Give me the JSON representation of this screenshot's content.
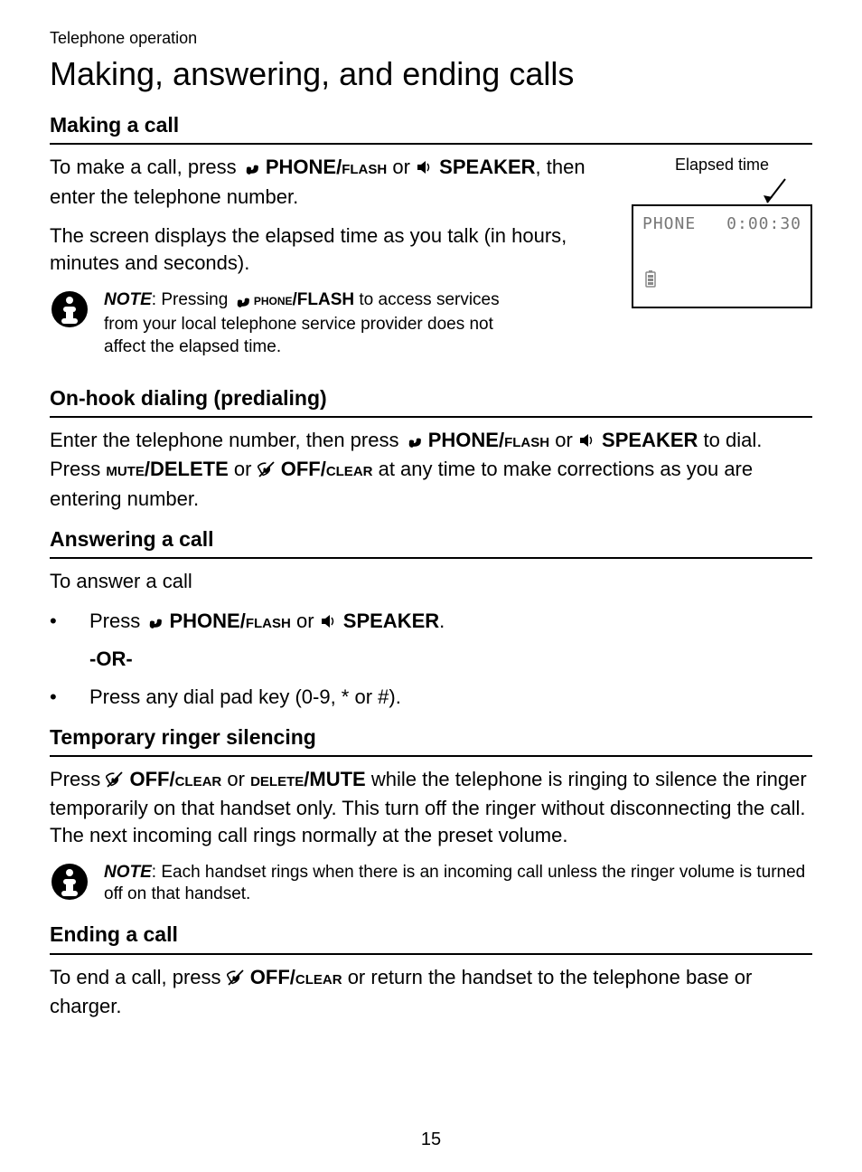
{
  "breadcrumb": "Telephone operation",
  "page_title": "Making, answering, and ending calls",
  "page_number": "15",
  "labels": {
    "phone_flash": "PHONE/",
    "phone_flash_sc": "flash",
    "speaker": "SPEAKER",
    "mute_delete_sc": "mute",
    "mute_delete": "/DELETE",
    "off_clear": "OFF/",
    "off_clear_sc": "clear",
    "delete_mute_sc": "delete",
    "delete_mute": "/MUTE",
    "note": "NOTE",
    "or": "-OR-"
  },
  "screen": {
    "elapsed_label": "Elapsed time",
    "line1_left": "PHONE",
    "line1_right": "0:00:30"
  },
  "sections": {
    "making": {
      "title": "Making a call",
      "p1a": "To make a call, press ",
      "p1b": ", then enter the telephone number.",
      "p2": "The screen displays the elapsed time as you talk (in hours, minutes and seconds).",
      "note": ": Pressing ",
      "note_b": " to access services from your local telephone service provider does not affect the elapsed time."
    },
    "onhook": {
      "title": "On-hook dialing (predialing)",
      "p1a": "Enter the telephone number, then press ",
      "p1b": " to dial. Press ",
      "p1c": " at any time to make corrections as you are entering number."
    },
    "answering": {
      "title": "Answering a call",
      "p1": "To answer a call",
      "b1a": "Press ",
      "b1_or": " or ",
      "b2": "Press any dial pad key (0-9, * or #)."
    },
    "ringer": {
      "title": "Temporary ringer silencing",
      "p1a": "Press ",
      "p1_or": " or ",
      "p1b": " while the telephone is ringing to silence the ringer temporarily on that handset only. This turn off the ringer without disconnecting the call. The next incoming call rings normally at the preset volume.",
      "note": ": Each handset rings when there is an incoming call unless the ringer volume is turned off on that handset."
    },
    "ending": {
      "title": "Ending a call",
      "p1a": "To end a call, press ",
      "p1b": " or return the handset to the telephone base or charger."
    }
  }
}
